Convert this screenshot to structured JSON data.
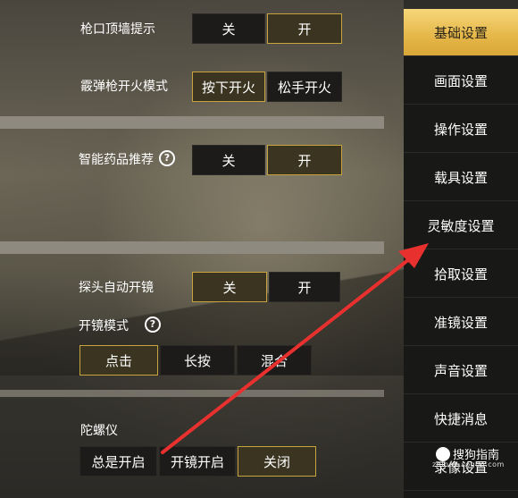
{
  "settings": {
    "muzzle_wall": {
      "label": "枪口顶墙提示",
      "options": [
        "关",
        "开"
      ],
      "selected": "开"
    },
    "shotgun_fire": {
      "label": "霰弹枪开火模式",
      "options": [
        "按下开火",
        "松手开火"
      ],
      "selected": "按下开火"
    },
    "smart_meds": {
      "label": "智能药品推荐",
      "help": "?",
      "options": [
        "关",
        "开"
      ],
      "selected": "开"
    },
    "peek_scope": {
      "label": "探头自动开镜",
      "options": [
        "关",
        "开"
      ],
      "selected": "关"
    },
    "scope_mode": {
      "label": "开镜模式",
      "help": "?",
      "options": [
        "点击",
        "长按",
        "混合"
      ],
      "selected": "点击"
    },
    "gyroscope": {
      "label": "陀螺仪",
      "options": [
        "总是开启",
        "开镜开启",
        "关闭"
      ],
      "selected": "关闭"
    }
  },
  "sidebar": {
    "items": [
      {
        "label": "基础设置",
        "active": true
      },
      {
        "label": "画面设置",
        "active": false
      },
      {
        "label": "操作设置",
        "active": false
      },
      {
        "label": "载具设置",
        "active": false
      },
      {
        "label": "灵敏度设置",
        "active": false
      },
      {
        "label": "拾取设置",
        "active": false
      },
      {
        "label": "准镜设置",
        "active": false
      },
      {
        "label": "声音设置",
        "active": false
      },
      {
        "label": "快捷消息",
        "active": false
      },
      {
        "label": "录像设置",
        "active": false
      }
    ]
  },
  "watermark": {
    "text": "搜狗指南",
    "sub": "zhinan.sogou.com"
  },
  "colors": {
    "selected_border": "#c8a441",
    "active_tab": "#e5b648",
    "arrow": "#e8312f"
  }
}
